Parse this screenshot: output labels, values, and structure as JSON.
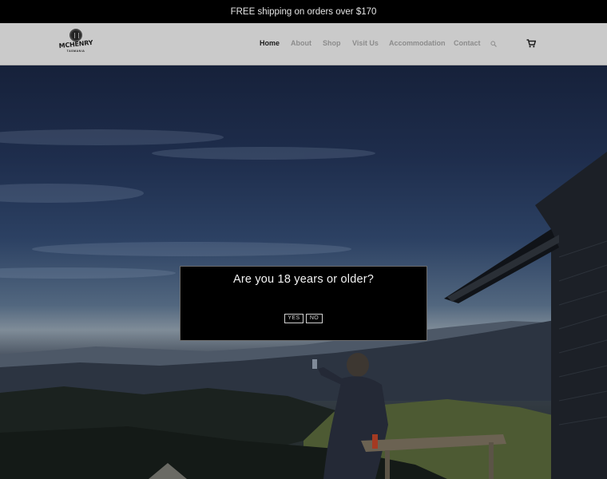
{
  "promo": {
    "text": "FREE shipping on orders over $170"
  },
  "logo": {
    "name": "MCHENRY",
    "sub": "TASMANIA"
  },
  "nav": {
    "items": [
      {
        "label": "Home",
        "active": true
      },
      {
        "label": "About",
        "active": false
      },
      {
        "label": "Shop",
        "active": false
      },
      {
        "label": "Visit Us",
        "active": false
      },
      {
        "label": "Accommodation",
        "active": false
      },
      {
        "label": "Contact",
        "active": false
      }
    ],
    "search_icon": "search-icon",
    "cart_icon": "cart-icon"
  },
  "age_gate": {
    "question": "Are you 18 years or older?",
    "yes_label": "YES",
    "no_label": "NO"
  },
  "colors": {
    "promo_bg": "#000000",
    "header_bg": "#cacaca",
    "nav_active": "#1b1b1b",
    "nav_inactive": "#8c8c8c",
    "modal_bg": "#000000"
  }
}
